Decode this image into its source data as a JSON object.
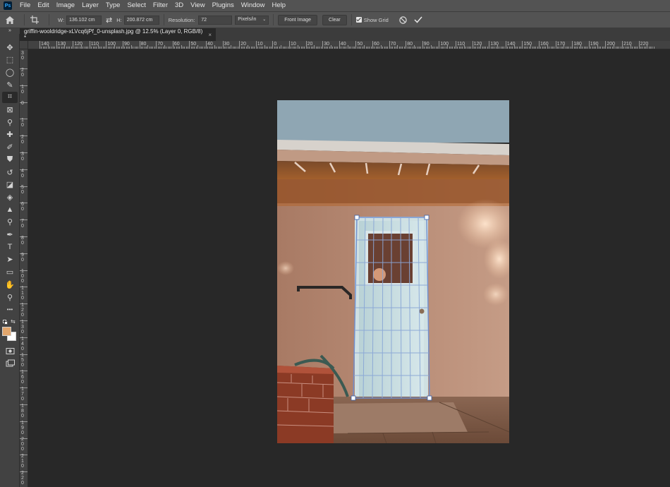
{
  "menubar": {
    "logo": "Ps",
    "items": [
      "File",
      "Edit",
      "Image",
      "Layer",
      "Type",
      "Select",
      "Filter",
      "3D",
      "View",
      "Plugins",
      "Window",
      "Help"
    ]
  },
  "options": {
    "width_label": "W:",
    "width_value": "136.102 cm",
    "height_label": "H:",
    "height_value": "200.872 cm",
    "resolution_label": "Resolution:",
    "resolution_value": "72",
    "units_value": "Pixels/in",
    "front_image_label": "Front Image",
    "clear_label": "Clear",
    "show_grid_label": "Show Grid",
    "show_grid_checked": true
  },
  "panel_collapse": "»",
  "document_tab": {
    "title": "griffin-wooldridge-xLVcq6jPf_0-unsplash.jpg @ 12.5% (Layer 0, RGB/8) *",
    "close": "×"
  },
  "hruler_labels": [
    "140",
    "130",
    "120",
    "110",
    "100",
    "90",
    "80",
    "70",
    "60",
    "50",
    "40",
    "30",
    "20",
    "10",
    "0",
    "10",
    "20",
    "30",
    "40",
    "50",
    "60",
    "70",
    "80",
    "90",
    "100",
    "110",
    "120",
    "130",
    "140",
    "150",
    "160",
    "170",
    "180",
    "190",
    "200",
    "210",
    "220"
  ],
  "vruler_labels": [
    "3 0",
    "2 0",
    "1 0",
    "0",
    "1 0",
    "2 0",
    "3 0",
    "4 0",
    "5 0",
    "6 0",
    "7 0",
    "8 0",
    "9 0",
    "1 0 0",
    "1 1 0",
    "1 2 0",
    "1 3 0",
    "1 4 0",
    "1 5 0",
    "1 6 0",
    "1 7 0",
    "1 8 0",
    "1 9 0",
    "2 0 0",
    "2 1 0",
    "2 2 0"
  ],
  "colors": {
    "foreground": "#e2a66c",
    "background": "#ffffff",
    "accent": "#31a8ff"
  },
  "tools": [
    {
      "name": "move-tool-icon",
      "glyph": "✥"
    },
    {
      "name": "marquee-tool-icon",
      "glyph": "⬚"
    },
    {
      "name": "lasso-tool-icon",
      "glyph": "◯"
    },
    {
      "name": "quick-selection-tool-icon",
      "glyph": "✎"
    },
    {
      "name": "perspective-crop-tool-icon",
      "glyph": "⌗",
      "active": true
    },
    {
      "name": "frame-tool-icon",
      "glyph": "⊠"
    },
    {
      "name": "eyedropper-tool-icon",
      "glyph": "⚲"
    },
    {
      "name": "healing-brush-tool-icon",
      "glyph": "✚"
    },
    {
      "name": "brush-tool-icon",
      "glyph": "✐"
    },
    {
      "name": "clone-stamp-tool-icon",
      "glyph": "⛊"
    },
    {
      "name": "history-brush-tool-icon",
      "glyph": "↺"
    },
    {
      "name": "eraser-tool-icon",
      "glyph": "◪"
    },
    {
      "name": "paint-bucket-tool-icon",
      "glyph": "◈"
    },
    {
      "name": "blur-tool-icon",
      "glyph": "▲"
    },
    {
      "name": "dodge-tool-icon",
      "glyph": "⚲"
    },
    {
      "name": "pen-tool-icon",
      "glyph": "✒"
    },
    {
      "name": "type-tool-icon",
      "glyph": "T"
    },
    {
      "name": "path-selection-tool-icon",
      "glyph": "➤"
    },
    {
      "name": "rectangle-tool-icon",
      "glyph": "▭"
    },
    {
      "name": "hand-tool-icon",
      "glyph": "✋"
    },
    {
      "name": "zoom-tool-icon",
      "glyph": "⚲"
    },
    {
      "name": "more-tools-icon",
      "glyph": "•••"
    }
  ]
}
